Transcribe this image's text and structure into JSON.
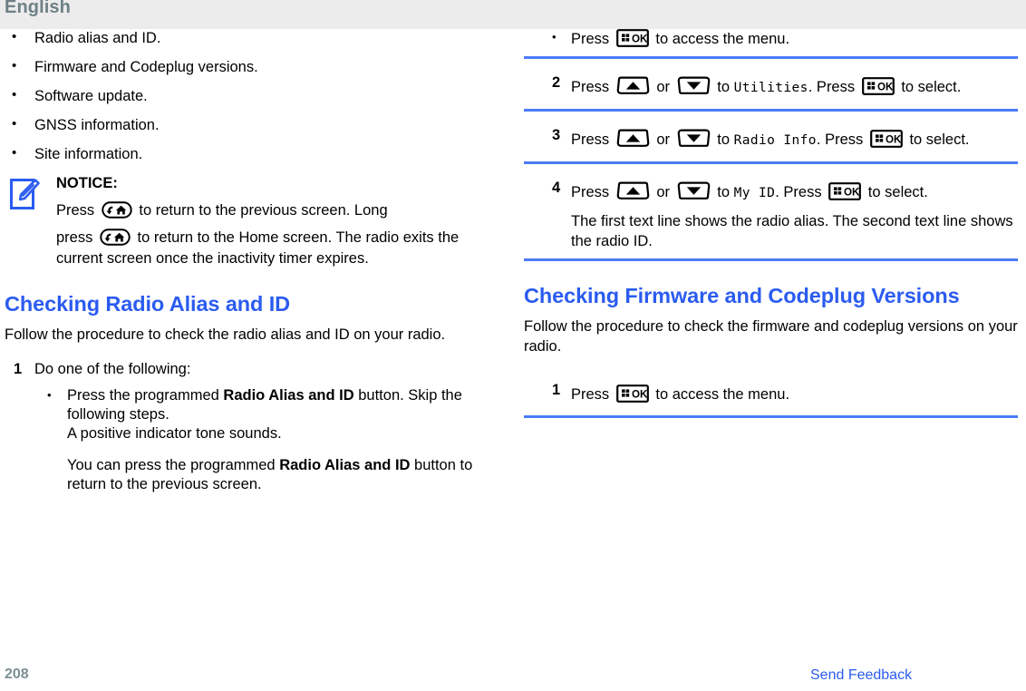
{
  "header": {
    "language": "English"
  },
  "left_column": {
    "info_list": [
      "Radio alias and ID.",
      "Firmware and Codeplug versions.",
      "Software update.",
      "GNSS information.",
      "Site information."
    ],
    "notice": {
      "icon": "notice-pencil-icon",
      "title": "NOTICE:",
      "line1_pre": "Press",
      "line1_post": "to return to the previous screen. Long",
      "line2_pre": "press",
      "line2_post": "to return to the Home screen. The radio exits the current screen once the inactivity timer expires."
    },
    "section": {
      "title": "Checking Radio Alias and ID",
      "intro": "Follow the procedure to check the radio alias and ID on your radio.",
      "step1": {
        "number": "1",
        "text": "Do one of the following:",
        "bullet_line1_pre": "Press the programmed ",
        "bullet_line1_bold": "Radio Alias and ID",
        "bullet_line1_post": " button. Skip the following steps.",
        "bullet_line2": "A positive indicator tone sounds.",
        "bullet_para_pre": "You can press the programmed ",
        "bullet_para_bold": "Radio Alias and ID",
        "bullet_para_post": " button to return to the previous screen."
      }
    }
  },
  "right_column": {
    "continued_bullet": {
      "pre": "Press",
      "post": "to access the menu."
    },
    "steps": [
      {
        "number": "2",
        "pre": "Press",
        "mid": "or",
        "to": "to",
        "target": "Utilities",
        "press2": ". Press",
        "tail": "to select."
      },
      {
        "number": "3",
        "pre": "Press",
        "mid": "or",
        "to": "to",
        "target": "Radio Info",
        "press2": ". Press",
        "tail": "to select."
      },
      {
        "number": "4",
        "pre": "Press",
        "mid": "or",
        "to": "to",
        "target": "My ID",
        "press2": ". Press",
        "tail": "to select.",
        "after": "The first text line shows the radio alias. The second text line shows the radio ID."
      }
    ],
    "section": {
      "title": "Checking Firmware and Codeplug Versions",
      "intro": "Follow the procedure to check the firmware and codeplug versions on your radio.",
      "step1": {
        "number": "1",
        "pre": "Press",
        "post": "to access the menu."
      }
    }
  },
  "footer": {
    "page_number": "208",
    "feedback_label": "Send Feedback"
  },
  "colors": {
    "accent_blue": "#2b5cf0",
    "rule_blue": "#4a7bf7",
    "header_band": "#ececec",
    "header_text": "#6e8085",
    "footer_page": "#7d8f94"
  },
  "icons": {
    "ok_key": "ok-menu-key-icon",
    "up_key": "up-arrow-key-icon",
    "down_key": "down-arrow-key-icon",
    "back_home_key": "back-home-key-icon"
  }
}
